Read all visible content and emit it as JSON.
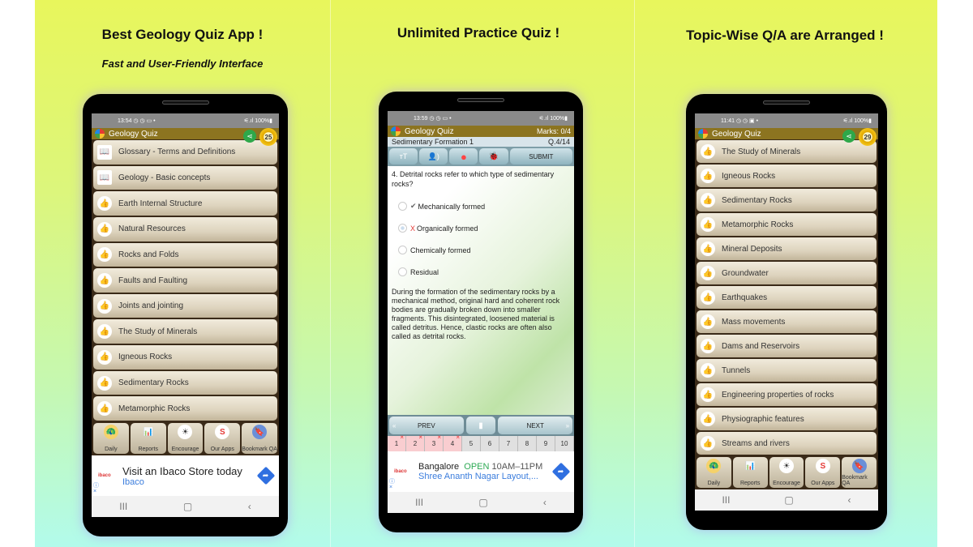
{
  "panels": [
    {
      "headline": "Best Geology Quiz App !",
      "subline": "Fast and User-Friendly Interface"
    },
    {
      "headline": "Unlimited Practice Quiz !"
    },
    {
      "headline": "Topic-Wise Q/A are Arranged !"
    }
  ],
  "phone1": {
    "status": {
      "time": "13:54 ◷ ◷ ▭ •",
      "right": "⚟.ıl 100%▮"
    },
    "app_title": "Geology Quiz",
    "share_icon": "share-icon",
    "medal_count": "25",
    "items": [
      {
        "label": "Glossary - Terms and Definitions",
        "icon": "book-reader-icon"
      },
      {
        "label": "Geology - Basic concepts",
        "icon": "book-reader-icon"
      },
      {
        "label": "Earth Internal Structure",
        "icon": "thumbs-up-icon"
      },
      {
        "label": "Natural Resources",
        "icon": "thumbs-up-icon"
      },
      {
        "label": "Rocks and Folds",
        "icon": "thumbs-up-icon"
      },
      {
        "label": "Faults and Faulting",
        "icon": "thumbs-up-icon"
      },
      {
        "label": "Joints and jointing",
        "icon": "thumbs-up-icon"
      },
      {
        "label": "The Study of Minerals",
        "icon": "thumbs-up-icon"
      },
      {
        "label": "Igneous Rocks",
        "icon": "thumbs-up-icon"
      },
      {
        "label": "Sedimentary Rocks",
        "icon": "thumbs-up-icon"
      },
      {
        "label": "Metamorphic Rocks",
        "icon": "thumbs-up-icon"
      }
    ],
    "bottom": [
      "Daily",
      "Reports",
      "Encourage",
      "Our Apps",
      "Bookmark QA"
    ],
    "ad": {
      "logo": "ibaco",
      "line1": "Visit an Ibaco Store today",
      "line2": "Ibaco"
    }
  },
  "phone2": {
    "status": {
      "time": "13:59 ◷ ◷ ▭ •",
      "right": "⚟.ıl 100%▮"
    },
    "app_title": "Geology Quiz",
    "marks": "Marks: 0/4",
    "quiz_name": "Sedimentary Formation 1",
    "qnum": "Q.4/14",
    "tools": [
      "тT",
      "👤)",
      "●",
      "🐞",
      "SUBMIT"
    ],
    "question": "4. Detrital rocks refer to which type of sedimentary rocks?",
    "options": [
      {
        "label": "Mechanically formed",
        "mark": "✔",
        "mark_color": "#666666",
        "selected": false
      },
      {
        "label": "Organically formed",
        "mark": "X",
        "mark_color": "#e53935",
        "selected": true
      },
      {
        "label": "Chemically formed",
        "mark": "",
        "selected": false
      },
      {
        "label": "Residual",
        "mark": "",
        "selected": false
      }
    ],
    "explanation": "During the formation of the sedimentary rocks by a mechanical method, original hard and coherent rock bodies are gradually broken down into smaller fragments. This disintegrated, loosened material is called detritus. Hence, clastic rocks are often also called as detrital rocks.",
    "prev": "PREV",
    "next": "NEXT",
    "numbers": [
      {
        "n": "1",
        "wrong": true
      },
      {
        "n": "2",
        "wrong": true
      },
      {
        "n": "3",
        "wrong": true
      },
      {
        "n": "4",
        "wrong": true
      },
      {
        "n": "5",
        "wrong": false
      },
      {
        "n": "6",
        "wrong": false
      },
      {
        "n": "7",
        "wrong": false
      },
      {
        "n": "8",
        "wrong": false
      },
      {
        "n": "9",
        "wrong": false
      },
      {
        "n": "10",
        "wrong": false
      }
    ],
    "ad": {
      "logo": "ibaco",
      "place": "Bangalore",
      "open": "OPEN",
      "hours": "10AM–11PM",
      "line2": "Shree Ananth Nagar Layout,..."
    }
  },
  "phone3": {
    "status": {
      "time": "11:41 ◷ ◷ ▣ •",
      "right": "⚟.ıl 100%▮"
    },
    "app_title": "Geology Quiz",
    "medal_count": "29",
    "items": [
      "The Study of Minerals",
      "Igneous Rocks",
      "Sedimentary Rocks",
      "Metamorphic Rocks",
      "Mineral Deposits",
      "Groundwater",
      "Earthquakes",
      "Mass movements",
      "Dams and Reservoirs",
      "Tunnels",
      "Engineering properties of rocks",
      "Physiographic features",
      "Streams and rivers"
    ],
    "bottom": [
      "Daily",
      "Reports",
      "Encourage",
      "Our Apps",
      "Bookmark QA"
    ]
  },
  "nav": {
    "recent": "III",
    "home": "▢",
    "back": "‹"
  },
  "colors": {
    "appbar": "#8c7420",
    "share": "#2ea84a",
    "ad_link": "#3b7ddd",
    "open": "#2eaa55"
  }
}
